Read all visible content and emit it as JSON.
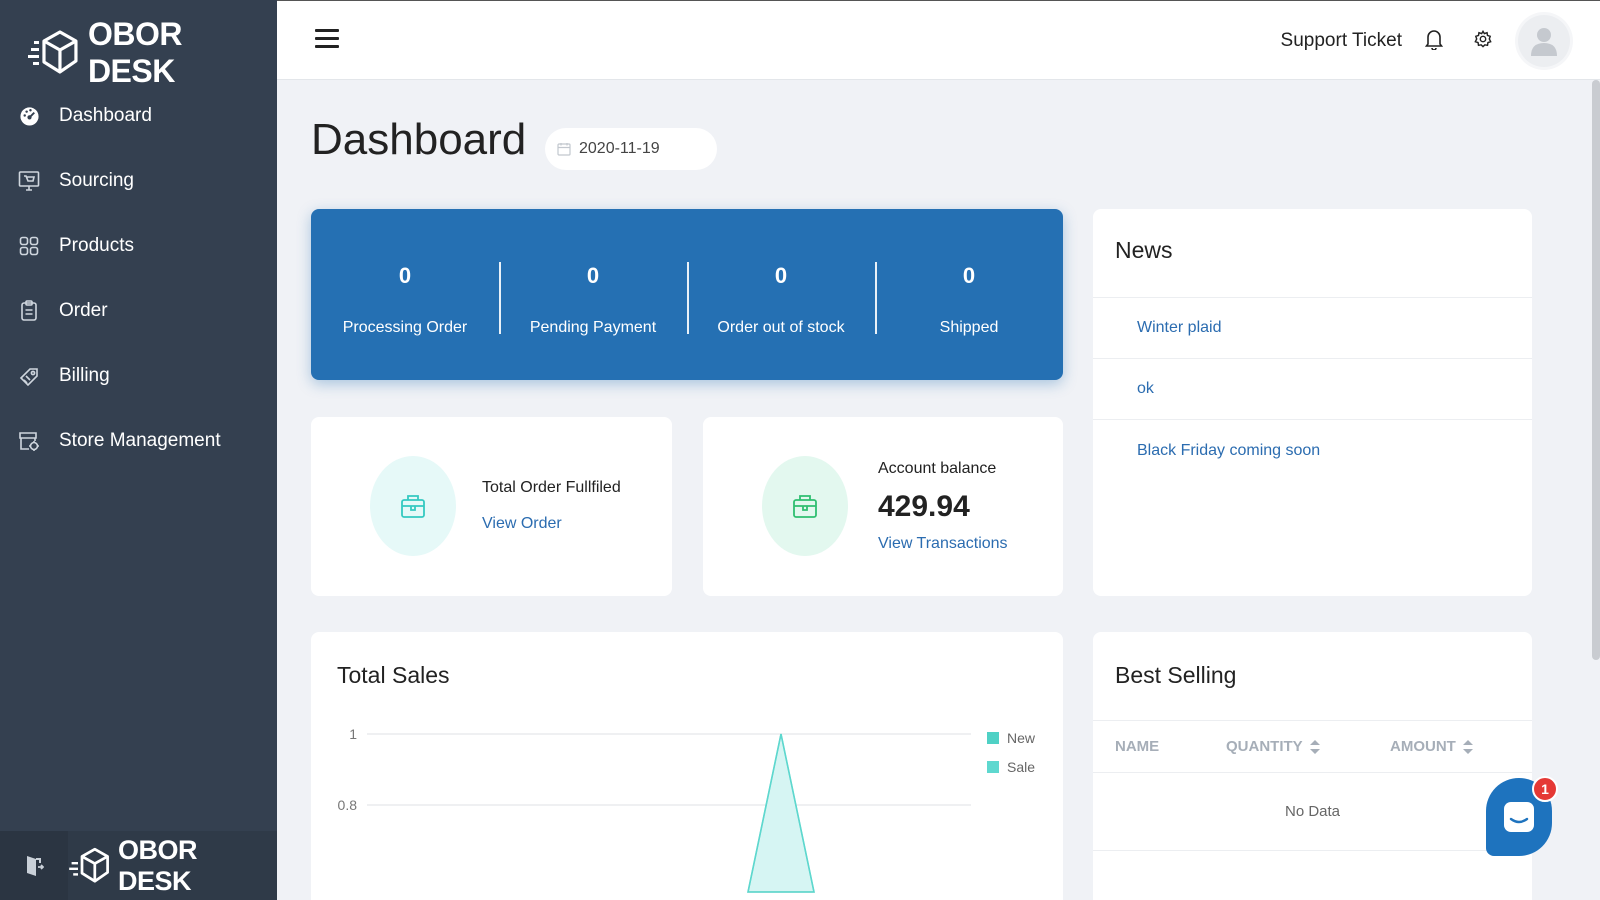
{
  "brand": {
    "name": "OBOR DESK"
  },
  "sidebar": {
    "items": [
      {
        "label": "Dashboard",
        "icon": "dashboard-icon"
      },
      {
        "label": "Sourcing",
        "icon": "sourcing-icon"
      },
      {
        "label": "Products",
        "icon": "products-icon"
      },
      {
        "label": "Order",
        "icon": "order-icon"
      },
      {
        "label": "Billing",
        "icon": "billing-icon"
      },
      {
        "label": "Store Management",
        "icon": "store-icon"
      }
    ],
    "footer_brand": "OBOR DESK"
  },
  "topbar": {
    "support_label": "Support Ticket"
  },
  "page": {
    "title": "Dashboard",
    "date": "2020-11-19"
  },
  "stats": [
    {
      "value": "0",
      "label": "Processing Order"
    },
    {
      "value": "0",
      "label": "Pending Payment"
    },
    {
      "value": "0",
      "label": "Order out of stock"
    },
    {
      "value": "0",
      "label": "Shipped"
    }
  ],
  "orders_card": {
    "title": "Total Order Fullfiled",
    "link": "View Order"
  },
  "balance_card": {
    "title": "Account balance",
    "amount": "429.94",
    "link": "View Transactions"
  },
  "news": {
    "title": "News",
    "items": [
      "Winter plaid",
      "ok",
      "Black Friday coming soon"
    ]
  },
  "sales": {
    "title": "Total Sales"
  },
  "chart_data": {
    "type": "area",
    "title": "Total Sales",
    "y_ticks": [
      "1",
      "0.8"
    ],
    "series": [
      {
        "name": "New",
        "color": "#4fd1c5"
      },
      {
        "name": "Sale",
        "color": "#5ed8cf"
      }
    ],
    "legend": "top-right",
    "grid": true
  },
  "best_selling": {
    "title": "Best Selling",
    "columns": [
      "NAME",
      "QUANTITY",
      "AMOUNT"
    ],
    "empty_text": "No Data"
  },
  "chat": {
    "badge": "1"
  },
  "colors": {
    "sidebar": "#344050",
    "accent": "#2570b3",
    "link": "#2b6cb0",
    "teal": "#4fd1c5"
  }
}
